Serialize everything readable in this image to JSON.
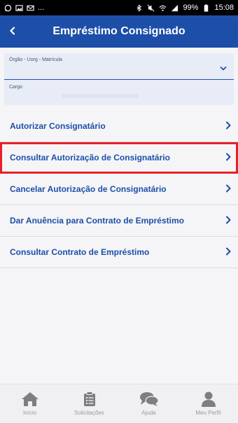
{
  "status_bar": {
    "left_icons": [
      "whatsapp-icon",
      "gallery-icon",
      "mail-icon"
    ],
    "dots": "...",
    "right_icons": [
      "bluetooth-icon",
      "mute-icon",
      "wifi-icon",
      "signal-icon"
    ],
    "battery": "99%",
    "time": "15:08"
  },
  "app_bar": {
    "title": "Empréstimo Consignado",
    "back_icon": "back-chevron-icon",
    "color": "#1d4fa8"
  },
  "form": {
    "field1_label": "Órgão - Uorg - Matrícula",
    "field2_label": "Cargo"
  },
  "menu": {
    "items": [
      {
        "label": "Autorizar Consignatário"
      },
      {
        "label": "Consultar Autorização de Consignatário",
        "highlighted": true
      },
      {
        "label": "Cancelar Autorização de Consignatário"
      },
      {
        "label": "Dar Anuência para Contrato de Empréstimo"
      },
      {
        "label": "Consultar Contrato de Empréstimo"
      }
    ]
  },
  "bottom_nav": {
    "items": [
      {
        "label": "Início",
        "icon": "home-icon"
      },
      {
        "label": "Solicitações",
        "icon": "clipboard-icon"
      },
      {
        "label": "Ajuda",
        "icon": "chat-icon"
      },
      {
        "label": "Meu Perfil",
        "icon": "profile-icon"
      }
    ]
  }
}
